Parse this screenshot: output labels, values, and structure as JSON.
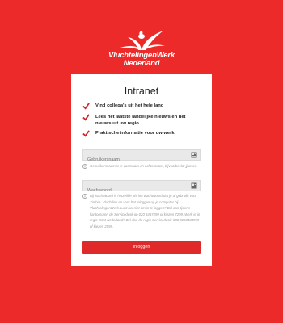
{
  "brand": {
    "line1": "VluchtelingenWerk",
    "line2": "Nederland"
  },
  "page": {
    "title": "Intranet"
  },
  "features": [
    "Vind collega's uit het hele land",
    "Lees het laatste landelijke nieuws én het nieuws uit uw regio",
    "Praktische informatie voor uw werk"
  ],
  "username": {
    "placeholder": "Gebruikersnaam",
    "value": "",
    "hint": "Gebruikersnaam is je voornaam en achternaam, bijvoorbeeld: jjansen."
  },
  "password": {
    "placeholder": "Wachtwoord",
    "value": "",
    "hint": "Bij wachtwoord is hetzelfde als het wachtwoord dat je al gebruikt voor Zimbra. Vluchtlink en voor het inloggen op je computer bij VluchtelingenWerk. Lukt het niet om in te loggen? Bel dan tijdens kantooruren de Servicedesk op 020 3467299 of kiezen 7299. Werk je in regio Oost-Nederland? Bel dan de regio Servicedesk: 088 0263434999 of kiezen 2999."
  },
  "actions": {
    "login_label": "Inloggen"
  },
  "colors": {
    "background": "#ec2a2a",
    "accent": "#e02a2a",
    "card": "#ffffff"
  }
}
